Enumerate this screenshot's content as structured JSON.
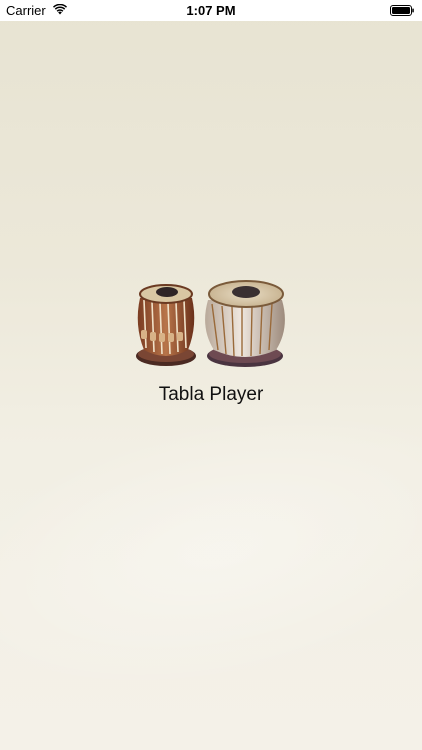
{
  "status_bar": {
    "carrier": "Carrier",
    "time": "1:07 PM",
    "wifi_icon": "wifi-icon",
    "battery_icon": "battery-icon"
  },
  "splash": {
    "logo_icon": "tabla-drums-icon",
    "title": "Tabla Player"
  },
  "colors": {
    "background_top": "#e7e3d2",
    "background_bottom": "#f4f1e8",
    "text": "#111111"
  }
}
